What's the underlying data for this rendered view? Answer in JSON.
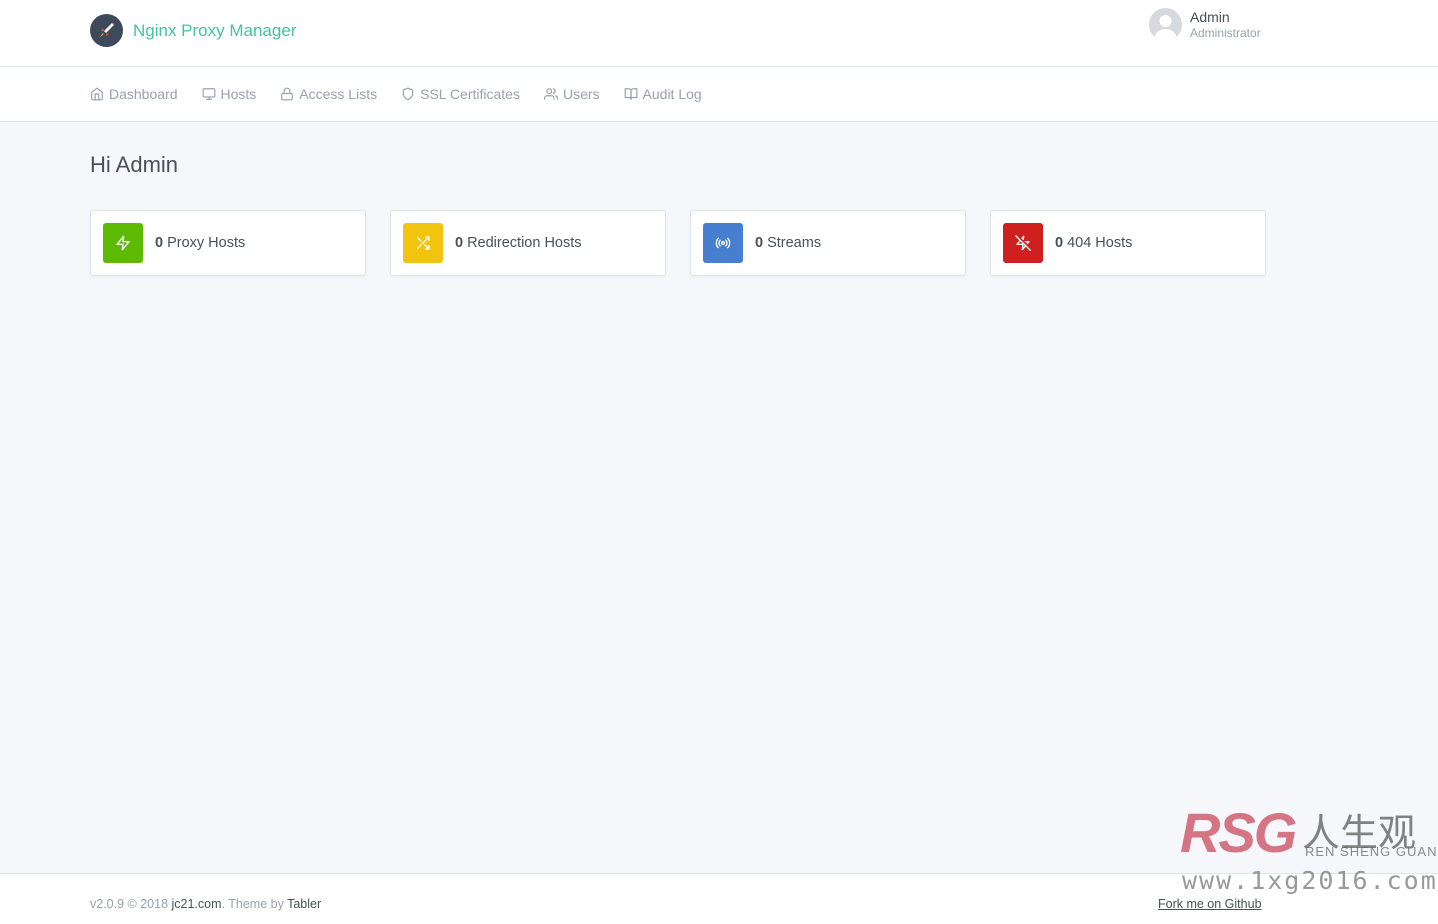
{
  "app": {
    "name": "Nginx Proxy Manager",
    "brand_color": "#45c1a4"
  },
  "user": {
    "name": "Admin",
    "role": "Administrator"
  },
  "nav": [
    {
      "label": "Dashboard",
      "icon": "home-icon"
    },
    {
      "label": "Hosts",
      "icon": "monitor-icon"
    },
    {
      "label": "Access Lists",
      "icon": "lock-icon"
    },
    {
      "label": "SSL Certificates",
      "icon": "shield-icon"
    },
    {
      "label": "Users",
      "icon": "users-icon"
    },
    {
      "label": "Audit Log",
      "icon": "book-icon"
    }
  ],
  "greeting": "Hi Admin",
  "cards": [
    {
      "count": "0",
      "label": "Proxy Hosts",
      "icon": "zap-icon",
      "color": "#5eba00"
    },
    {
      "count": "0",
      "label": "Redirection Hosts",
      "icon": "shuffle-icon",
      "color": "#f1c40f"
    },
    {
      "count": "0",
      "label": "Streams",
      "icon": "radio-icon",
      "color": "#467fcf"
    },
    {
      "count": "0",
      "label": "404 Hosts",
      "icon": "zap-off-icon",
      "color": "#cd201f"
    }
  ],
  "footer": {
    "version_prefix": "v2.0.9 © 2018",
    "company": "jc21.com",
    "theme_prefix": ". Theme by",
    "theme": "Tabler",
    "github": "Fork me on Github"
  },
  "watermark": {
    "logo": "RSG",
    "chinese": "人生观",
    "pinyin": "REN SHENG GUAN",
    "url": "www.1xg2016.com"
  }
}
